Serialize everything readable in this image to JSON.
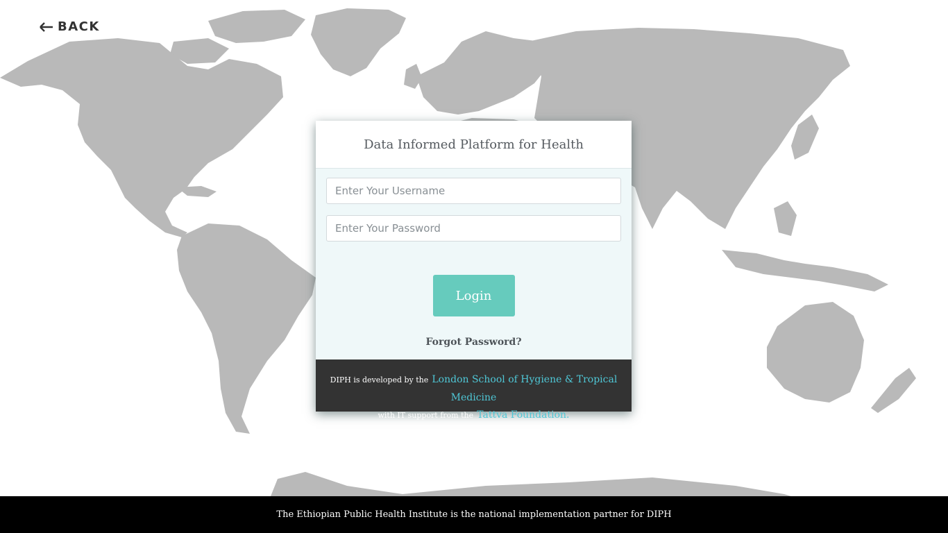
{
  "navigation": {
    "back_label": "BACK",
    "back_icon": "arrow-left-icon"
  },
  "background": {
    "map_icon": "world-map",
    "map_color": "#b9b9b9"
  },
  "login": {
    "title": "Data Informed Platform for Health",
    "username_placeholder": "Enter Your Username",
    "username_value": "",
    "password_placeholder": "Enter Your Password",
    "password_value": "",
    "login_button_label": "Login",
    "forgot_password_label": "Forgot Password?",
    "button_color": "#66cbbd"
  },
  "credits": {
    "line1_prefix": "DIPH is developed by the",
    "line1_link": "London School of Hygiene & Tropical Medicine",
    "line2_prefix": "with IT support from the",
    "line2_link": "Tattva Foundation.",
    "link_color": "#4fc7d6"
  },
  "footer": {
    "text": "The Ethiopian Public Health Institute is the national implementation partner for DIPH"
  }
}
